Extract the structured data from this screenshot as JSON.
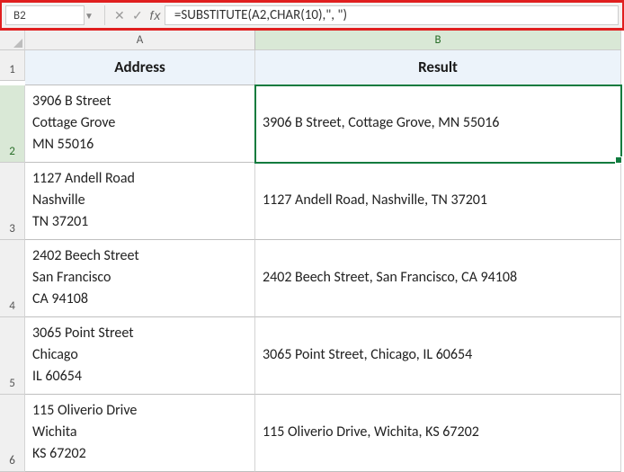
{
  "formula_bar": {
    "cell_ref": "B2",
    "fx_label": "fx",
    "formula": "=SUBSTITUTE(A2,CHAR(10),\", \")",
    "cancel": "✕",
    "enter": "✓"
  },
  "columns": {
    "A": "A",
    "B": "B"
  },
  "row_heads": [
    "1",
    "2",
    "3",
    "4",
    "5",
    "6"
  ],
  "headers": {
    "A": "Address",
    "B": "Result"
  },
  "rows": [
    {
      "address": "3906 B Street\nCottage Grove\nMN 55016",
      "result": "3906 B Street, Cottage Grove, MN 55016"
    },
    {
      "address": "1127 Andell Road\nNashville\nTN 37201",
      "result": "1127 Andell Road, Nashville, TN 37201"
    },
    {
      "address": "2402 Beech Street\nSan Francisco\nCA 94108",
      "result": "2402 Beech Street, San Francisco, CA 94108"
    },
    {
      "address": "3065 Point Street\nChicago\nIL 60654",
      "result": "3065 Point Street, Chicago, IL 60654"
    },
    {
      "address": "115 Oliverio Drive\nWichita\nKS 67202",
      "result": "115 Oliverio Drive, Wichita, KS 67202"
    }
  ]
}
